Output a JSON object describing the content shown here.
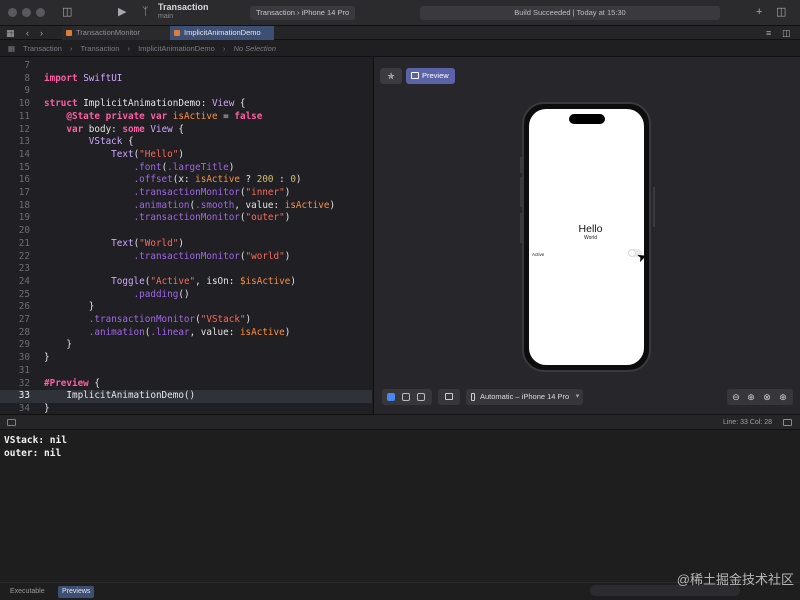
{
  "toolbar": {
    "scheme_title": "Transaction",
    "scheme_branch": "main",
    "destination_scheme": "Transaction",
    "destination_device": "iPhone 14 Pro",
    "status": "Build Succeeded | Today at 15:30"
  },
  "tabs": [
    {
      "label": "TransactionMonitor",
      "active": false
    },
    {
      "label": "ImplicitAnimationDemo",
      "active": true
    }
  ],
  "breadcrumb": [
    "Transaction",
    "Transaction",
    "ImplicitAnimationDemo",
    "No Selection"
  ],
  "editor": {
    "current_line": 33,
    "lines": [
      {
        "n": "7",
        "text": ""
      },
      {
        "n": "8",
        "text": "import SwiftUI"
      },
      {
        "n": "9",
        "text": ""
      },
      {
        "n": "10",
        "text": "struct ImplicitAnimationDemo: View {"
      },
      {
        "n": "11",
        "text": "    @State private var isActive = false"
      },
      {
        "n": "12",
        "text": "    var body: some View {"
      },
      {
        "n": "13",
        "text": "        VStack {"
      },
      {
        "n": "14",
        "text": "            Text(\"Hello\")"
      },
      {
        "n": "15",
        "text": "                .font(.largeTitle)"
      },
      {
        "n": "16",
        "text": "                .offset(x: isActive ? 200 : 0)"
      },
      {
        "n": "17",
        "text": "                .transactionMonitor(\"inner\")"
      },
      {
        "n": "18",
        "text": "                .animation(.smooth, value: isActive)"
      },
      {
        "n": "19",
        "text": "                .transactionMonitor(\"outer\")"
      },
      {
        "n": "20",
        "text": ""
      },
      {
        "n": "21",
        "text": "            Text(\"World\")"
      },
      {
        "n": "22",
        "text": "                .transactionMonitor(\"world\")"
      },
      {
        "n": "23",
        "text": ""
      },
      {
        "n": "24",
        "text": "            Toggle(\"Active\", isOn: $isActive)"
      },
      {
        "n": "25",
        "text": "                .padding()"
      },
      {
        "n": "26",
        "text": "        }"
      },
      {
        "n": "27",
        "text": "        .transactionMonitor(\"VStack\")"
      },
      {
        "n": "28",
        "text": "        .animation(.linear, value: isActive)"
      },
      {
        "n": "29",
        "text": "    }"
      },
      {
        "n": "30",
        "text": "}"
      },
      {
        "n": "31",
        "text": ""
      },
      {
        "n": "32",
        "text": "#Preview {"
      },
      {
        "n": "33",
        "text": "    ImplicitAnimationDemo()"
      },
      {
        "n": "34",
        "text": "}"
      }
    ]
  },
  "preview": {
    "preview_button": "Preview",
    "hello_text": "Hello",
    "world_text": "World",
    "toggle_label": "Active",
    "device_selector": "Automatic – iPhone 14 Pro"
  },
  "debug": {
    "line_col": "Line: 33  Col: 28"
  },
  "console": {
    "lines": [
      "VStack: nil",
      "outer: nil"
    ]
  },
  "bottom": {
    "tabs": [
      {
        "label": "Executable",
        "active": false
      },
      {
        "label": "Previews",
        "active": true
      }
    ],
    "watermark": "@稀土掘金技术社区"
  },
  "colors": {
    "keyword": "#fc5fa3",
    "type": "#d0a8ff",
    "function": "#a167e6",
    "string": "#fc6a5d",
    "number": "#d0bf69",
    "accent": "#5a62a8"
  }
}
